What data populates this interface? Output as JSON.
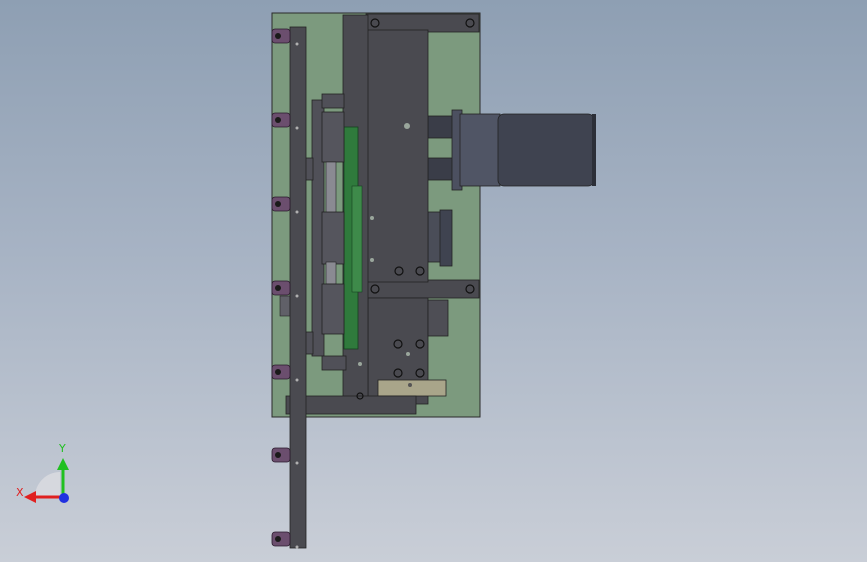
{
  "viewport": {
    "background_top": "#8e9fb3",
    "background_bottom": "#c9ced7"
  },
  "model": {
    "plate_color": "#7c9a7e",
    "frame_color": "#4a4a50",
    "bracket_color": "#6b4e6e",
    "motor_color": "#3f4350",
    "pcb_color": "#2f7a3c",
    "bronze_color": "#a9a58a"
  },
  "triad": {
    "x_label": "X",
    "y_label": "Y",
    "x_color": "#e02020",
    "y_color": "#20c020",
    "z_color": "#2030e0"
  }
}
